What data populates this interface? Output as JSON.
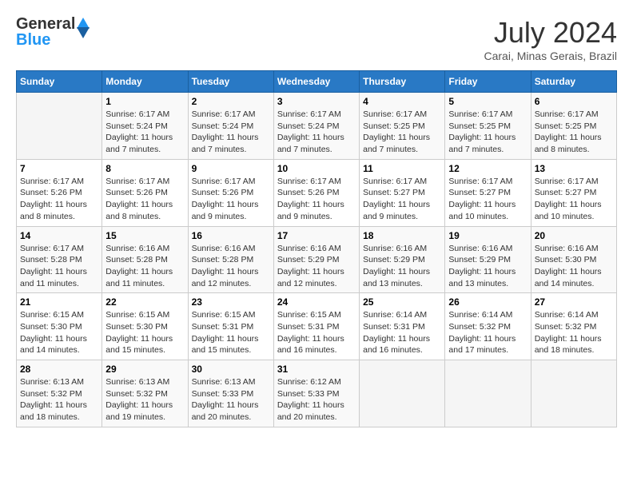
{
  "header": {
    "logo_line1": "General",
    "logo_line2": "Blue",
    "month": "July 2024",
    "location": "Carai, Minas Gerais, Brazil"
  },
  "weekdays": [
    "Sunday",
    "Monday",
    "Tuesday",
    "Wednesday",
    "Thursday",
    "Friday",
    "Saturday"
  ],
  "weeks": [
    [
      {
        "day": "",
        "info": ""
      },
      {
        "day": "1",
        "info": "Sunrise: 6:17 AM\nSunset: 5:24 PM\nDaylight: 11 hours\nand 7 minutes."
      },
      {
        "day": "2",
        "info": "Sunrise: 6:17 AM\nSunset: 5:24 PM\nDaylight: 11 hours\nand 7 minutes."
      },
      {
        "day": "3",
        "info": "Sunrise: 6:17 AM\nSunset: 5:24 PM\nDaylight: 11 hours\nand 7 minutes."
      },
      {
        "day": "4",
        "info": "Sunrise: 6:17 AM\nSunset: 5:25 PM\nDaylight: 11 hours\nand 7 minutes."
      },
      {
        "day": "5",
        "info": "Sunrise: 6:17 AM\nSunset: 5:25 PM\nDaylight: 11 hours\nand 7 minutes."
      },
      {
        "day": "6",
        "info": "Sunrise: 6:17 AM\nSunset: 5:25 PM\nDaylight: 11 hours\nand 8 minutes."
      }
    ],
    [
      {
        "day": "7",
        "info": "Sunrise: 6:17 AM\nSunset: 5:26 PM\nDaylight: 11 hours\nand 8 minutes."
      },
      {
        "day": "8",
        "info": "Sunrise: 6:17 AM\nSunset: 5:26 PM\nDaylight: 11 hours\nand 8 minutes."
      },
      {
        "day": "9",
        "info": "Sunrise: 6:17 AM\nSunset: 5:26 PM\nDaylight: 11 hours\nand 9 minutes."
      },
      {
        "day": "10",
        "info": "Sunrise: 6:17 AM\nSunset: 5:26 PM\nDaylight: 11 hours\nand 9 minutes."
      },
      {
        "day": "11",
        "info": "Sunrise: 6:17 AM\nSunset: 5:27 PM\nDaylight: 11 hours\nand 9 minutes."
      },
      {
        "day": "12",
        "info": "Sunrise: 6:17 AM\nSunset: 5:27 PM\nDaylight: 11 hours\nand 10 minutes."
      },
      {
        "day": "13",
        "info": "Sunrise: 6:17 AM\nSunset: 5:27 PM\nDaylight: 11 hours\nand 10 minutes."
      }
    ],
    [
      {
        "day": "14",
        "info": "Sunrise: 6:17 AM\nSunset: 5:28 PM\nDaylight: 11 hours\nand 11 minutes."
      },
      {
        "day": "15",
        "info": "Sunrise: 6:16 AM\nSunset: 5:28 PM\nDaylight: 11 hours\nand 11 minutes."
      },
      {
        "day": "16",
        "info": "Sunrise: 6:16 AM\nSunset: 5:28 PM\nDaylight: 11 hours\nand 12 minutes."
      },
      {
        "day": "17",
        "info": "Sunrise: 6:16 AM\nSunset: 5:29 PM\nDaylight: 11 hours\nand 12 minutes."
      },
      {
        "day": "18",
        "info": "Sunrise: 6:16 AM\nSunset: 5:29 PM\nDaylight: 11 hours\nand 13 minutes."
      },
      {
        "day": "19",
        "info": "Sunrise: 6:16 AM\nSunset: 5:29 PM\nDaylight: 11 hours\nand 13 minutes."
      },
      {
        "day": "20",
        "info": "Sunrise: 6:16 AM\nSunset: 5:30 PM\nDaylight: 11 hours\nand 14 minutes."
      }
    ],
    [
      {
        "day": "21",
        "info": "Sunrise: 6:15 AM\nSunset: 5:30 PM\nDaylight: 11 hours\nand 14 minutes."
      },
      {
        "day": "22",
        "info": "Sunrise: 6:15 AM\nSunset: 5:30 PM\nDaylight: 11 hours\nand 15 minutes."
      },
      {
        "day": "23",
        "info": "Sunrise: 6:15 AM\nSunset: 5:31 PM\nDaylight: 11 hours\nand 15 minutes."
      },
      {
        "day": "24",
        "info": "Sunrise: 6:15 AM\nSunset: 5:31 PM\nDaylight: 11 hours\nand 16 minutes."
      },
      {
        "day": "25",
        "info": "Sunrise: 6:14 AM\nSunset: 5:31 PM\nDaylight: 11 hours\nand 16 minutes."
      },
      {
        "day": "26",
        "info": "Sunrise: 6:14 AM\nSunset: 5:32 PM\nDaylight: 11 hours\nand 17 minutes."
      },
      {
        "day": "27",
        "info": "Sunrise: 6:14 AM\nSunset: 5:32 PM\nDaylight: 11 hours\nand 18 minutes."
      }
    ],
    [
      {
        "day": "28",
        "info": "Sunrise: 6:13 AM\nSunset: 5:32 PM\nDaylight: 11 hours\nand 18 minutes."
      },
      {
        "day": "29",
        "info": "Sunrise: 6:13 AM\nSunset: 5:32 PM\nDaylight: 11 hours\nand 19 minutes."
      },
      {
        "day": "30",
        "info": "Sunrise: 6:13 AM\nSunset: 5:33 PM\nDaylight: 11 hours\nand 20 minutes."
      },
      {
        "day": "31",
        "info": "Sunrise: 6:12 AM\nSunset: 5:33 PM\nDaylight: 11 hours\nand 20 minutes."
      },
      {
        "day": "",
        "info": ""
      },
      {
        "day": "",
        "info": ""
      },
      {
        "day": "",
        "info": ""
      }
    ]
  ]
}
